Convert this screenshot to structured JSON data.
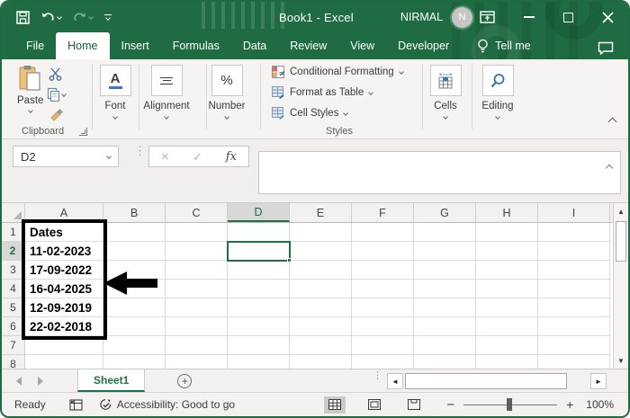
{
  "colors": {
    "accent_green": "#217346",
    "titlebar_green": "#1F6C43",
    "selection_green": "#1E7145",
    "range_border": "#000000",
    "ribbon_bg": "#f5f4f2"
  },
  "title_bar": {
    "title": "Book1  -  Excel",
    "user": "NIRMAL",
    "avatar_initial": "N"
  },
  "tabs": {
    "items": [
      "File",
      "Home",
      "Insert",
      "Formulas",
      "Data",
      "Review",
      "View",
      "Developer"
    ],
    "active": "Home",
    "tell_me": "Tell me"
  },
  "ribbon": {
    "clipboard": {
      "paste_label": "Paste",
      "group_label": "Clipboard"
    },
    "collapsed_groups": [
      {
        "label": "Font",
        "glyph": "A"
      },
      {
        "label": "Alignment"
      },
      {
        "label": "Number",
        "glyph": "%"
      }
    ],
    "styles": {
      "items": [
        "Conditional Formatting",
        "Format as Table",
        "Cell Styles"
      ],
      "group_label": "Styles"
    },
    "cells_label": "Cells",
    "editing_label": "Editing"
  },
  "formula_bar": {
    "name_box": "D2",
    "fx_label": "fx",
    "cancel_glyph": "×",
    "enter_glyph": "✓",
    "value": ""
  },
  "grid": {
    "columns": [
      "A",
      "B",
      "C",
      "D",
      "E",
      "F",
      "G",
      "H",
      "I"
    ],
    "rows": [
      "1",
      "2",
      "3",
      "4",
      "5",
      "6",
      "7",
      "8"
    ],
    "selected": {
      "col": "D",
      "row": "2",
      "cell": "D2"
    },
    "cells": {
      "A1": "Dates",
      "A2": "11-02-2023",
      "A3": "17-09-2022",
      "A4": "16-04-2025",
      "A5": "12-09-2019",
      "A6": "22-02-2018"
    },
    "highlighted_range": "A1:A6",
    "annotation": "black-arrow-pointing-at-A4"
  },
  "sheet_bar": {
    "active_tab": "Sheet1",
    "add_label": "+"
  },
  "status_bar": {
    "mode": "Ready",
    "accessibility": "Accessibility: Good to go",
    "zoom_level": "100%",
    "zoom_out_glyph": "−",
    "zoom_in_glyph": "+"
  }
}
